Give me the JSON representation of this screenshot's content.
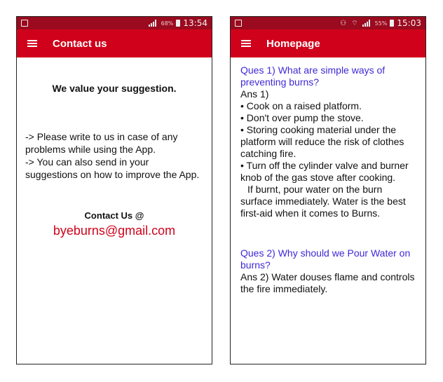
{
  "contact_screen": {
    "status": {
      "battery_pct": "68%",
      "time": "13:54"
    },
    "appbar_title": "Contact us",
    "headline": "We value your suggestion.",
    "lines": [
      "-> Please write to us in case of any problems while using the App.",
      "-> You can also send in your suggestions on how to improve the App."
    ],
    "contact_label": "Contact Us @",
    "email": "byeburns@gmail.com"
  },
  "home_screen": {
    "status": {
      "battery_pct": "55%",
      "time": "15:03"
    },
    "appbar_title": "Homepage",
    "q1": {
      "question": "Ques 1) What are simple ways of preventing burns?",
      "answer_title": "Ans 1)",
      "bullets": [
        "• Cook on a raised platform.",
        "• Don't over pump the stove.",
        "• Storing cooking material under the platform will reduce the risk of clothes catching fire.",
        "• Turn off the cylinder valve and burner knob of the gas stove after cooking.",
        "If burnt, pour water on the burn surface immediately. Water is the best first-aid when it comes to Burns."
      ]
    },
    "q2": {
      "question": "Ques 2) Why should we Pour Water on burns?",
      "answer": "Ans 2) Water douses flame and controls the fire immediately."
    }
  },
  "colors": {
    "statusbar": "#9b0a1e",
    "appbar": "#d0021b",
    "question": "#3f28d6",
    "email": "#d0021b"
  }
}
